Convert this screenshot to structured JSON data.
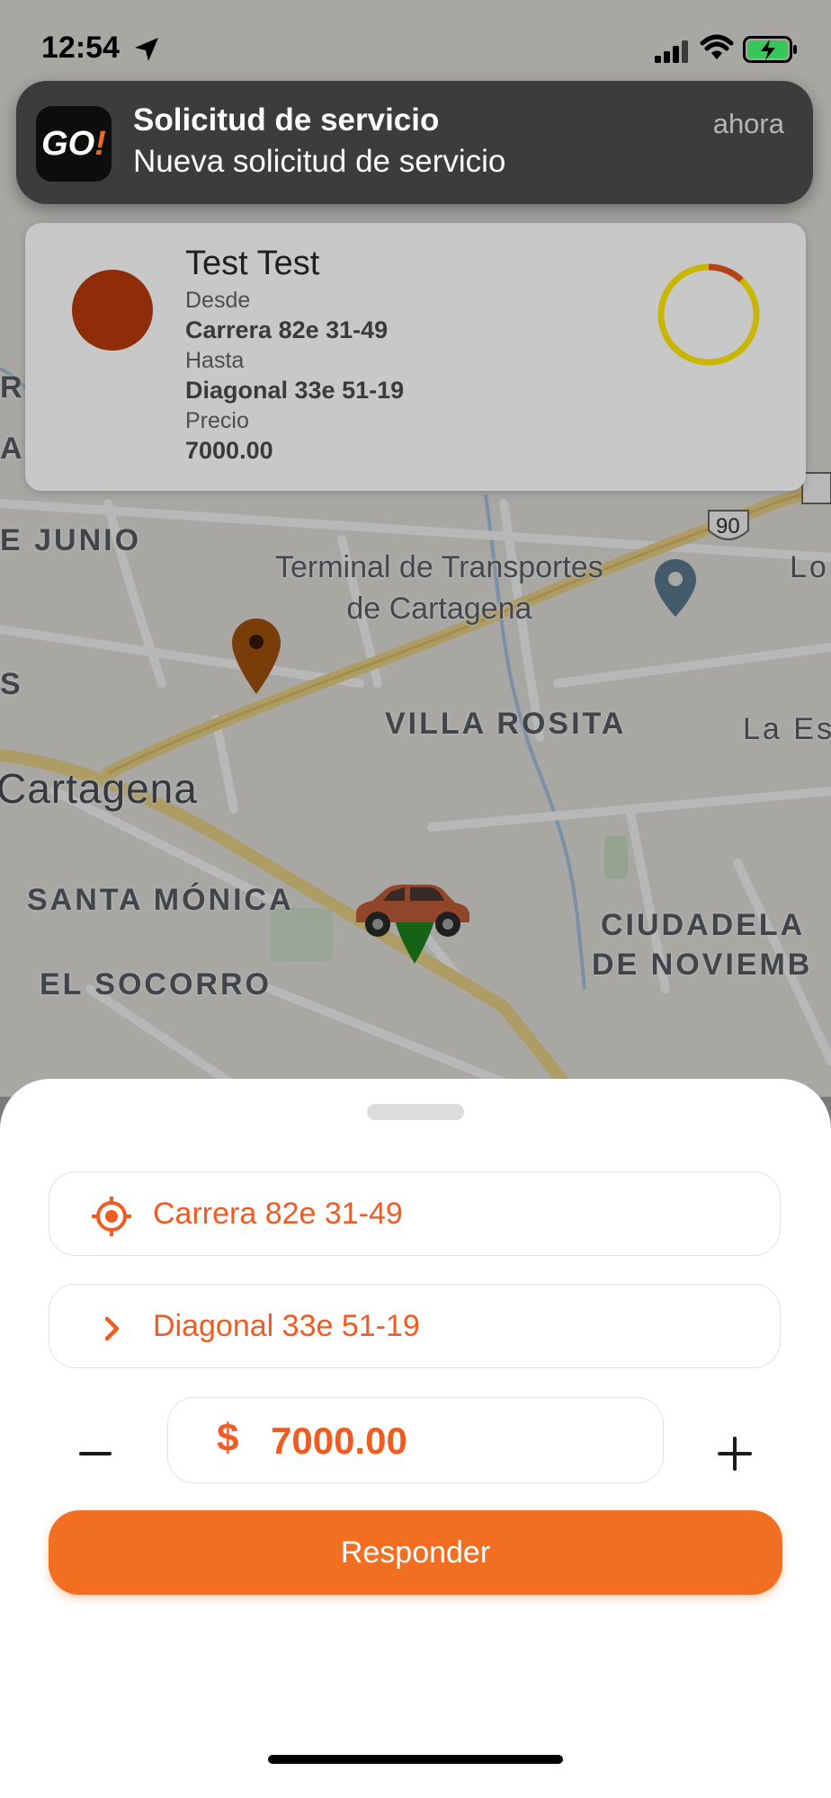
{
  "status_bar": {
    "time": "12:54"
  },
  "notification": {
    "app_icon_text_main": "GO",
    "app_icon_text_accent": "!",
    "title": "Solicitud de servicio",
    "body": "Nueva solicitud de servicio",
    "time": "ahora"
  },
  "request_card": {
    "passenger_name": "Test Test",
    "from_label": "Desde",
    "from_value": "Carrera 82e 31-49",
    "to_label": "Hasta",
    "to_value": "Diagonal 33e 51-19",
    "price_label": "Precio",
    "price_value": "7000.00",
    "timer_remaining_fraction": 0.88
  },
  "map": {
    "labels": {
      "de_junio": "E JUNIO",
      "terminal_line1": "Terminal de Transportes",
      "terminal_line2": "de Cartagena",
      "villa_rosita": "VILLA ROSITA",
      "cartagena": "Cartagena",
      "santa_monica": "SANTA MÓNICA",
      "el_socorro": "EL SOCORRO",
      "ciudadela_line1": "CIUDADELA",
      "ciudadela_line2": "DE NOVIEMB",
      "la_es": "La Es",
      "lo": "Lo",
      "route_90": "90",
      "left_r": "R",
      "left_an": "AN",
      "left_s": "S"
    },
    "colors": {
      "origin_pin": "#a8550f",
      "driver_pin": "#1e8a21",
      "car": "#c9603a"
    }
  },
  "bottom_sheet": {
    "origin_address": "Carrera 82e 31-49",
    "destination_address": "Diagonal 33e 51-19",
    "currency_symbol": "$",
    "price": "7000.00",
    "respond_button_label": "Responder"
  },
  "theme": {
    "accent": "#f26f22",
    "text_accent": "#ef5b21"
  }
}
